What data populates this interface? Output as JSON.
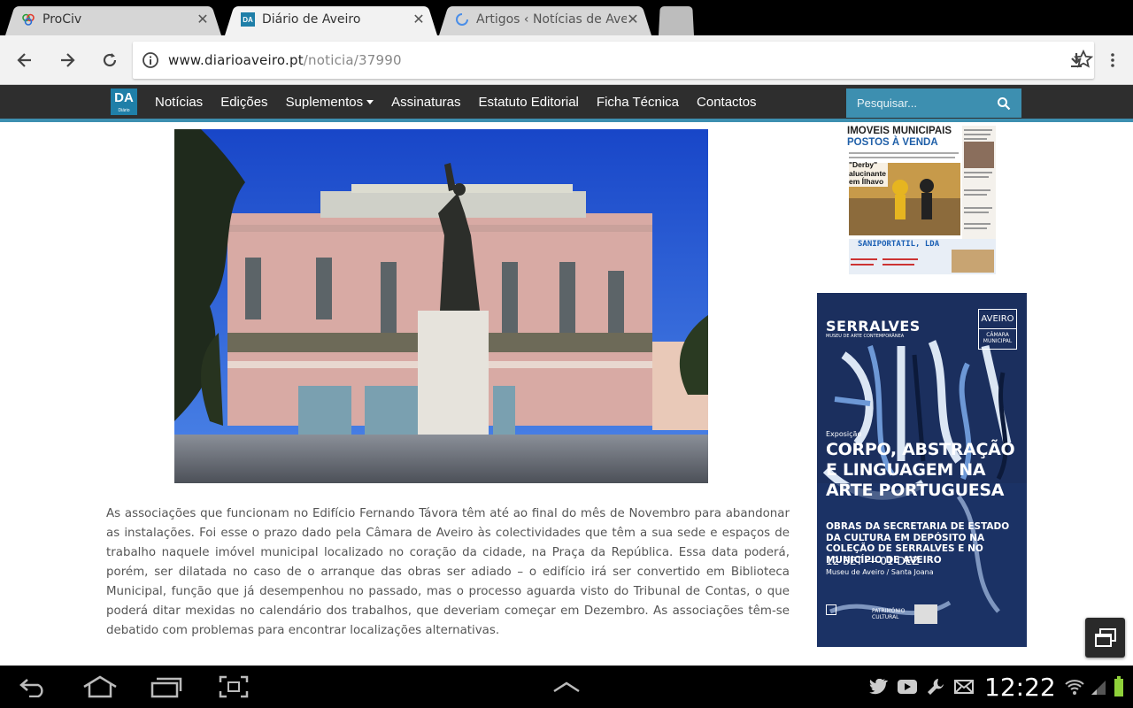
{
  "browser": {
    "tabs": [
      {
        "title": "ProCiv",
        "active": false
      },
      {
        "title": "Diário de Aveiro",
        "active": true
      },
      {
        "title": "Artigos ‹ Notícias de Aveiro —",
        "active": false
      }
    ],
    "url_host": "www.diarioaveiro.pt",
    "url_path": "/noticia/37990"
  },
  "site": {
    "logo_text": "DA",
    "logo_sub": "Diário",
    "nav": [
      "Notícias",
      "Edições",
      "Suplementos",
      "Assinaturas",
      "Estatuto Editorial",
      "Ficha Técnica",
      "Contactos"
    ],
    "search_placeholder": "Pesquisar...",
    "accent": "#3d8fb0",
    "nav_bg": "#2e2e2e"
  },
  "article": {
    "body": "As associações que funcionam no Edifício Fernando Távora têm até ao final do mês de Novembro para abandonar as instalações. Foi esse o prazo dado pela Câmara de Aveiro às colectividades que têm a sua sede e espaços de trabalho naquele imóvel municipal localizado no coração da cidade, na Praça da República. Essa data poderá, porém, ser dilatada no caso de o arranque das obras ser adiado – o edifício irá ser convertido em Biblioteca Municipal, função que já desempenhou no passado, mas o processo aguarda visto do Tribunal de Contas, o que poderá ditar mexidas no calendário dos trabalhos, que deveriam começar em Dezembro. As associações têm-se debatido com problemas para encontrar localizações alternativas."
  },
  "ads": {
    "paper": {
      "headline1": "IMOVEIS MUNICIPAIS",
      "headline2": "POSTOS À VENDA",
      "derby": "\"Derby\" alucinante em Ílhavo",
      "sponsor": "SANIPORTATIL, LDA"
    },
    "serralves": {
      "brand": "SERRALVES",
      "brand_sub": "MUSEU DE ARTE CONTEMPORÂNEA",
      "city": "AVEIRO",
      "city_sub": "CÂMARA MUNICIPAL",
      "label": "Exposição",
      "title": "CORPO, ABSTRAÇÃO E LINGUAGEM NA ARTE PORTUGUESA",
      "subtitle": "OBRAS DA SECRETARIA DE ESTADO DA CULTURA EM DEPÓSITO NA COLEÇÃO DE SERRALVES E NO MUNICÍPIO DE AVEIRO",
      "dates": "12 SET — 01 DEZ",
      "venue": "Museu de Aveiro / Santa Joana",
      "footer": "PATRIMÓNIO CULTURAL"
    }
  },
  "system": {
    "time": "12:22"
  }
}
